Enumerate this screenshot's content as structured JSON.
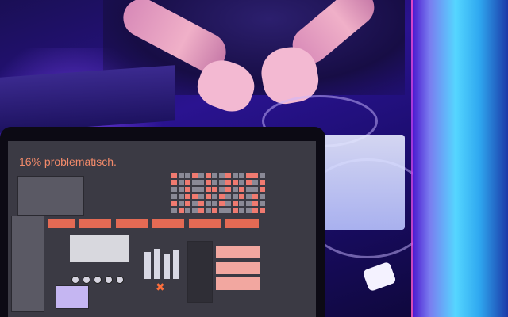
{
  "photo": {
    "screen_title": "16% problematisch."
  }
}
